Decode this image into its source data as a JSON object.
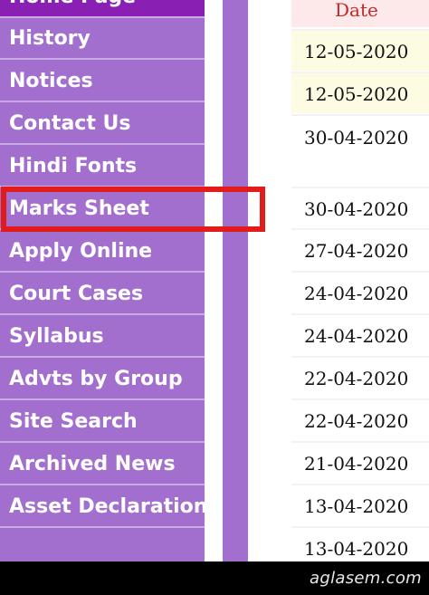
{
  "nav": {
    "items": [
      {
        "label": "Home Page"
      },
      {
        "label": "History"
      },
      {
        "label": "Notices"
      },
      {
        "label": "Contact Us"
      },
      {
        "label": "Hindi Fonts"
      },
      {
        "label": "Marks Sheet"
      },
      {
        "label": "Apply Online"
      },
      {
        "label": "Court Cases"
      },
      {
        "label": "Syllabus"
      },
      {
        "label": "Advts by Group"
      },
      {
        "label": "Site Search"
      },
      {
        "label": "Archived News"
      },
      {
        "label": "Asset Declaration"
      }
    ],
    "highlighted_item": "Marks Sheet"
  },
  "table": {
    "header": "Date",
    "dates": [
      "12-05-2020",
      "12-05-2020",
      "30-04-2020",
      "30-04-2020",
      "27-04-2020",
      "24-04-2020",
      "24-04-2020",
      "22-04-2020",
      "22-04-2020",
      "21-04-2020",
      "13-04-2020",
      "13-04-2020"
    ]
  },
  "footer": {
    "watermark": "aglasem.com"
  },
  "colors": {
    "nav_bg": "#a36fcf",
    "nav_top_bg": "#8a1fb3",
    "highlight_border": "#e21b1b",
    "date_header_text": "#c62828",
    "date_header_bg": "#fde9e9",
    "recent_row_bg": "#fefbe3"
  }
}
